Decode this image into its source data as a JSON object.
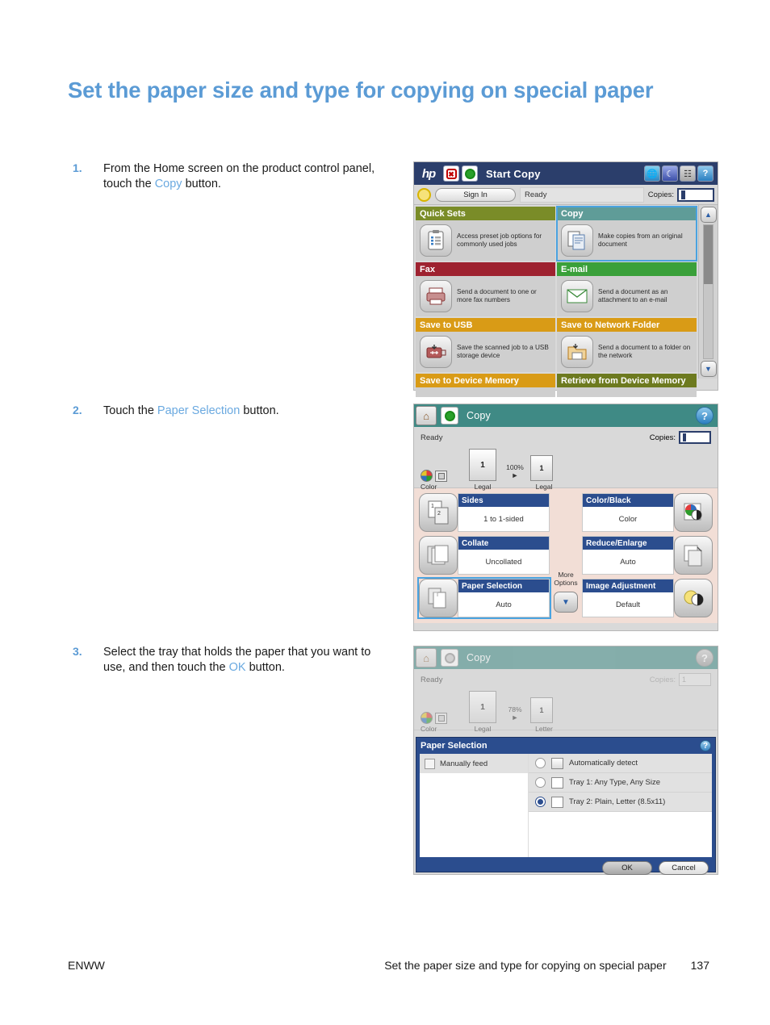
{
  "page": {
    "title": "Set the paper size and type for copying on special paper",
    "footer_left": "ENWW",
    "footer_center": "Set the paper size and type for copying on special paper",
    "footer_page": "137"
  },
  "steps": [
    {
      "num": "1.",
      "pre": "From the Home screen on the product control panel, touch the ",
      "link": "Copy",
      "post": " button."
    },
    {
      "num": "2.",
      "pre": "Touch the ",
      "link": "Paper Selection",
      "post": " button."
    },
    {
      "num": "3.",
      "pre": "Select the tray that holds the paper that you want to use, and then touch the ",
      "link": "OK",
      "post": " button."
    }
  ],
  "screen1": {
    "titlebar": {
      "brand": "hp",
      "title": "Start Copy",
      "stop_icon": "stop-icon",
      "start_icon": "start-icon",
      "right_icons": [
        "globe-icon",
        "sleep-icon",
        "network-icon",
        "help-icon"
      ]
    },
    "status": {
      "power_icon": "power-icon",
      "sign_in": "Sign In",
      "state": "Ready",
      "copies_label": "Copies:",
      "copies_value": "1"
    },
    "tiles": [
      {
        "title": "Quick Sets",
        "desc": "Access preset job options for commonly used jobs",
        "color": "#7a8c28",
        "icon": "quick-sets-icon",
        "selected": false
      },
      {
        "title": "Copy",
        "desc": "Make copies from an original document",
        "color": "#5f9c98",
        "icon": "copy-icon",
        "selected": true
      },
      {
        "title": "Fax",
        "desc": "Send a document to one or more fax numbers",
        "color": "#9e2230",
        "icon": "fax-icon",
        "selected": false
      },
      {
        "title": "E-mail",
        "desc": "Send a document as an attachment to an e-mail",
        "color": "#3aa03a",
        "icon": "email-icon",
        "selected": false
      },
      {
        "title": "Save to USB",
        "desc": "Save the scanned job to a USB storage device",
        "color": "#d99b16",
        "icon": "usb-icon",
        "selected": false
      },
      {
        "title": "Save to Network Folder",
        "desc": "Send a document to a folder on the network",
        "color": "#d99b16",
        "icon": "network-folder-icon",
        "selected": false
      },
      {
        "title": "Save to Device Memory",
        "desc": "",
        "color": "#d99b16",
        "icon": "device-memory-icon",
        "selected": false
      },
      {
        "title": "Retrieve from Device Memory",
        "desc": "",
        "color": "#6d7a1f",
        "icon": "retrieve-icon",
        "selected": false
      }
    ],
    "scroll": {
      "up": "▲",
      "down": "▼"
    }
  },
  "screen2": {
    "titlebar": {
      "home_icon": "home-icon",
      "start_icon": "start-icon",
      "title": "Copy",
      "help_icon": "help-icon"
    },
    "preview": {
      "state": "Ready",
      "copies_label": "Copies:",
      "copies_value": "1",
      "color_mode": "Color",
      "source_page": "1",
      "source_size": "Legal",
      "zoom": "100%",
      "dest_page": "1",
      "dest_size": "Legal"
    },
    "options_left": [
      {
        "title": "Sides",
        "value": "1 to 1-sided",
        "icon": "sides-icon",
        "selected": false
      },
      {
        "title": "Collate",
        "value": "Uncollated",
        "icon": "collate-icon",
        "selected": false
      },
      {
        "title": "Paper Selection",
        "value": "Auto",
        "icon": "paper-selection-icon",
        "selected": true
      }
    ],
    "options_right": [
      {
        "title": "Color/Black",
        "value": "Color",
        "icon": "color-black-icon",
        "selected": false
      },
      {
        "title": "Reduce/Enlarge",
        "value": "Auto",
        "icon": "reduce-enlarge-icon",
        "selected": false
      },
      {
        "title": "Image Adjustment",
        "value": "Default",
        "icon": "image-adjustment-icon",
        "selected": false
      }
    ],
    "more_options_label": "More Options",
    "more_options_icon": "chevron-down-icon"
  },
  "screen3": {
    "titlebar": {
      "home_icon": "home-icon",
      "start_icon": "start-icon",
      "title": "Copy",
      "help_icon": "help-icon"
    },
    "preview": {
      "state": "Ready",
      "copies_label": "Copies:",
      "copies_value": "1",
      "color_mode": "Color",
      "source_page": "1",
      "source_size": "Legal",
      "zoom": "78%",
      "dest_page": "1",
      "dest_size": "Letter"
    },
    "dialog": {
      "title": "Paper Selection",
      "help_icon": "help-icon",
      "manual_feed_label": "Manually feed",
      "manual_feed_checked": false,
      "trays": [
        {
          "label": "Automatically detect",
          "selected": false,
          "icon": "auto-detect-icon"
        },
        {
          "label": "Tray 1: Any Type, Any Size",
          "selected": false,
          "icon": "tray-icon"
        },
        {
          "label": "Tray 2: Plain, Letter (8.5x11)",
          "selected": true,
          "icon": "tray-icon"
        }
      ],
      "ok_label": "OK",
      "cancel_label": "Cancel"
    }
  },
  "colors": {
    "heading": "#5b9bd5",
    "link": "#6aa9e0",
    "titlebar_navy": "#2b3e6b",
    "titlebar_teal": "#3f8a85",
    "option_header": "#2b4d8e",
    "options_bg": "#f2ded6"
  }
}
